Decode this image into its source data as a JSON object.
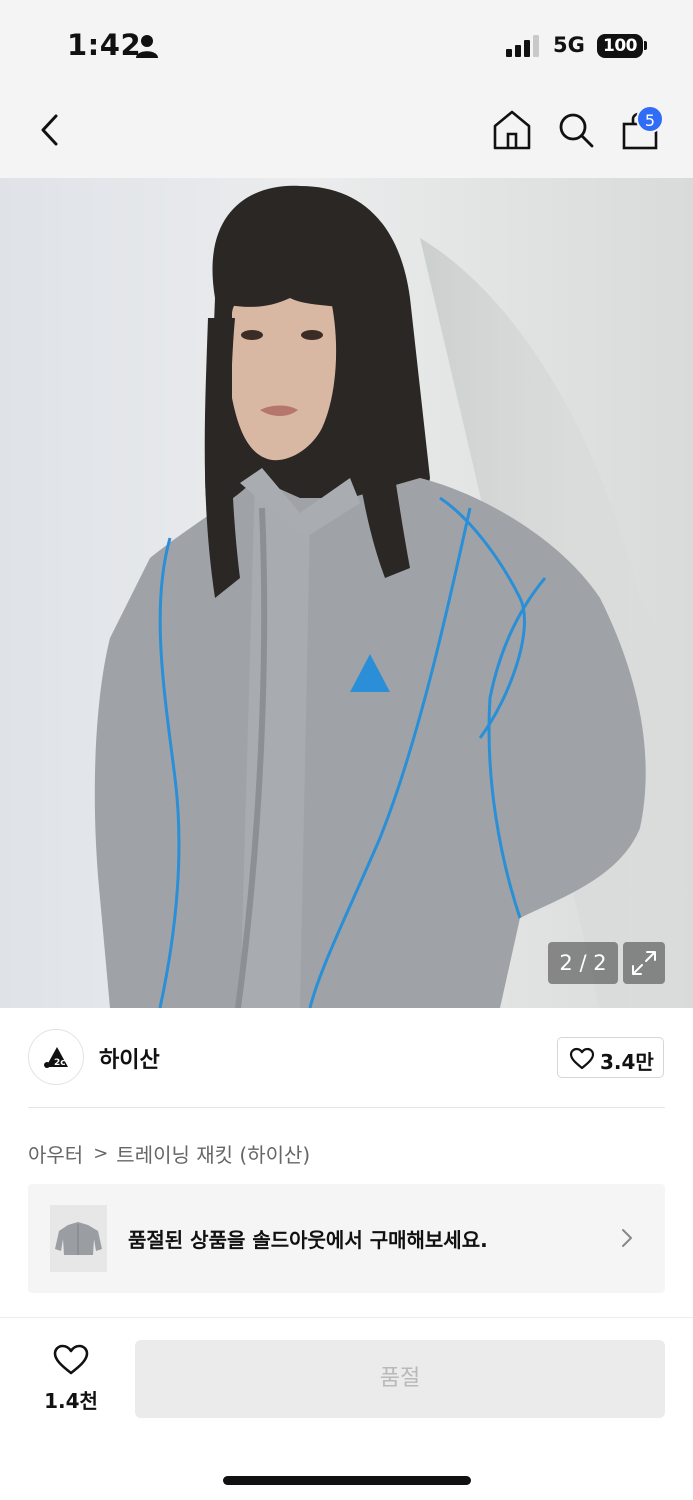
{
  "status_bar": {
    "time": "1:42",
    "network": "5G",
    "battery": "100"
  },
  "nav": {
    "back_icon": "chevron-left-icon",
    "home_icon": "home-icon",
    "search_icon": "search-icon",
    "cart_icon": "shopping-bag-icon",
    "cart_badge": "5"
  },
  "gallery": {
    "counter": "2 / 2",
    "expand_icon": "expand-icon"
  },
  "brand": {
    "name": "하이산",
    "like_count": "3.4만"
  },
  "breadcrumb": {
    "category": "아우터",
    "separator": ">",
    "product": "트레이닝 재킷 (하이산)"
  },
  "soldout_banner": {
    "text": "품절된 상품을 솔드아웃에서 구매해보세요."
  },
  "bottom_bar": {
    "wish_count": "1.4천",
    "buy_label": "품절"
  },
  "colors": {
    "badge_blue": "#2f6df6",
    "jacket_trim": "#2a8fd6",
    "disabled_bg": "#ebebeb",
    "disabled_text": "#b9b9b9"
  }
}
